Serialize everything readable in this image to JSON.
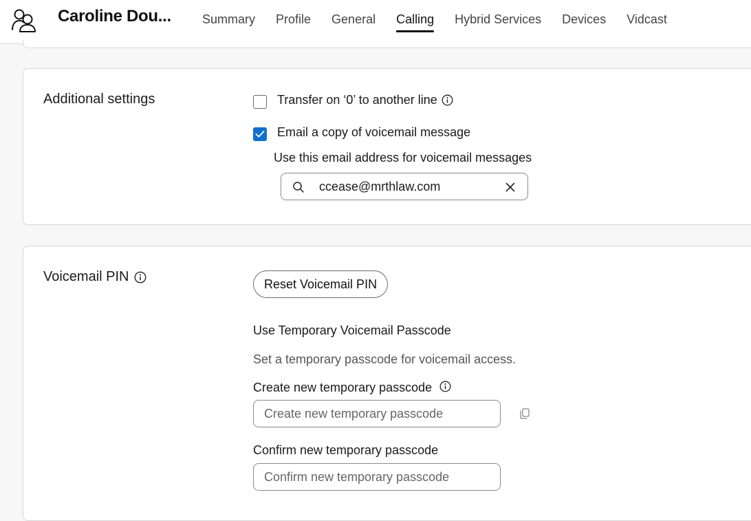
{
  "header": {
    "user_name": "Caroline Dou...",
    "tabs": [
      {
        "label": "Summary",
        "active": false
      },
      {
        "label": "Profile",
        "active": false
      },
      {
        "label": "General",
        "active": false
      },
      {
        "label": "Calling",
        "active": true
      },
      {
        "label": "Hybrid Services",
        "active": false
      },
      {
        "label": "Devices",
        "active": false
      },
      {
        "label": "Vidcast",
        "active": false
      }
    ]
  },
  "additional_settings": {
    "title": "Additional settings",
    "transfer_option": {
      "label": "Transfer on ‘0’ to another line",
      "checked": false
    },
    "email_option": {
      "label": "Email a copy of voicemail message",
      "checked": true
    },
    "email_help": "Use this email address for voicemail messages",
    "email_value": "ccease@mrthlaw.com"
  },
  "voicemail_pin": {
    "title": "Voicemail PIN",
    "reset_button_label": "Reset Voicemail PIN",
    "temp_title": "Use Temporary Voicemail Passcode",
    "temp_description": "Set a temporary passcode for voicemail access.",
    "create_label": "Create new temporary passcode",
    "create_placeholder": "Create new temporary passcode",
    "confirm_label": "Confirm new temporary passcode",
    "confirm_placeholder": "Confirm new temporary passcode"
  },
  "colors": {
    "accent": "#1170cf",
    "border": "#d6d6d6",
    "background": "#f7f7f7"
  },
  "icons": {
    "user": "user-group-icon",
    "info": "info-circle-icon",
    "search": "search-icon",
    "clear": "close-icon",
    "copy": "copy-icon",
    "check": "checkmark-icon"
  }
}
